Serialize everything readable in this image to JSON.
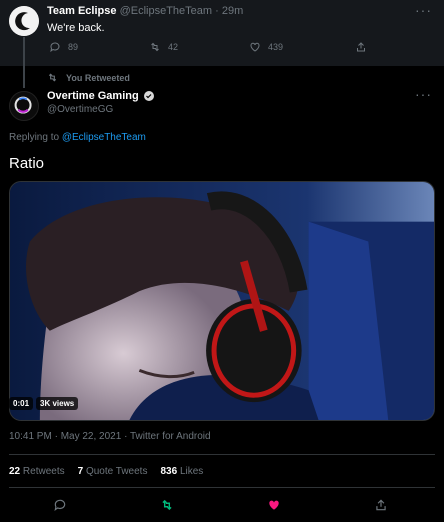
{
  "top_tweet": {
    "display_name": "Team Eclipse",
    "handle": "@EclipseTheTeam",
    "separator": "·",
    "age": "29m",
    "text": "We're back.",
    "more": "···",
    "replies": "89",
    "retweets": "42",
    "likes": "439"
  },
  "retweet_banner": {
    "label": "You Retweeted"
  },
  "main_tweet": {
    "display_name": "Overtime Gaming",
    "handle": "@OvertimeGG",
    "more": "···",
    "replying_prefix": "Replying to",
    "replying_handle": "@EclipseTheTeam",
    "text": "Ratio",
    "video_time": "0:01",
    "video_views": "3K views",
    "timestamp": "10:41 PM · May 22, 2021 · Twitter for Android"
  },
  "stats": {
    "retweets_count": "22",
    "retweets_label": "Retweets",
    "quotes_count": "7",
    "quotes_label": "Quote Tweets",
    "likes_count": "836",
    "likes_label": "Likes"
  },
  "colors": {
    "accent": "#1d9bf0",
    "retweet_green": "#00ba7c",
    "like_pink": "#f91880",
    "muted": "#6e767d"
  }
}
